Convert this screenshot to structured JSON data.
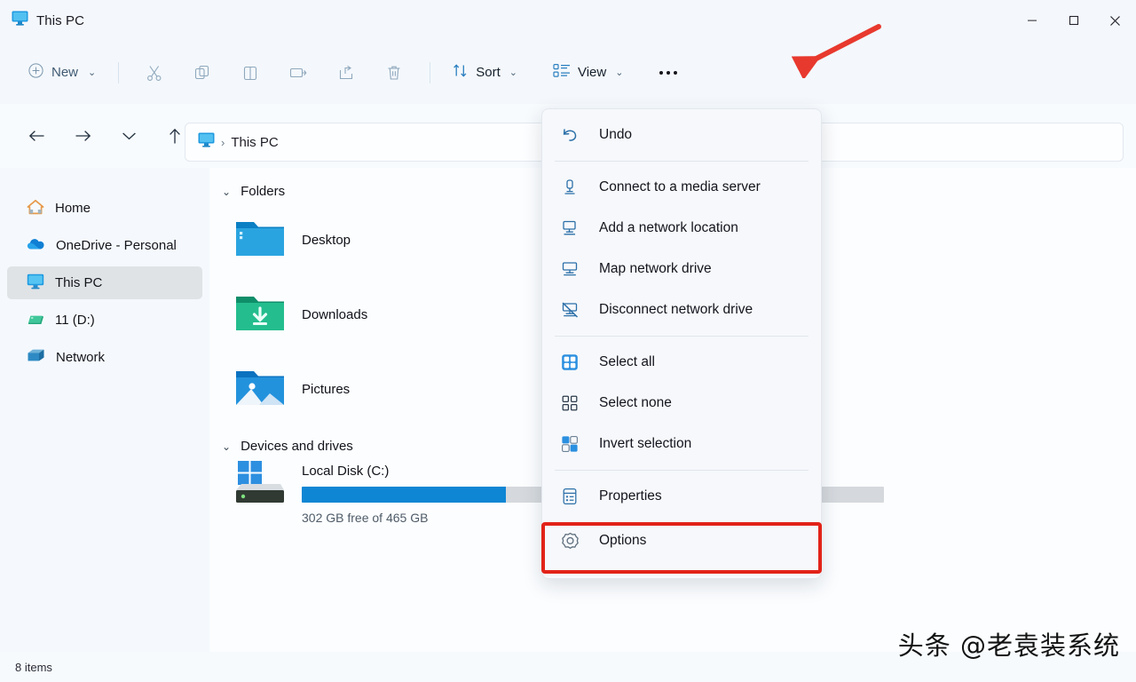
{
  "window": {
    "title": "This PC",
    "title_icon": "this-pc-monitor-icon",
    "controls": {
      "minimize": "─",
      "maximize": "□",
      "close": "✕"
    }
  },
  "toolbar": {
    "new_label": "New",
    "new_chevron": "⌄",
    "icons": [
      "cut-icon",
      "copy-icon",
      "paste-icon",
      "rename-icon",
      "share-icon",
      "delete-icon"
    ],
    "sort_label": "Sort",
    "sort_chevron": "⌄",
    "view_label": "View",
    "view_chevron": "⌄",
    "more_label": "•••"
  },
  "navigation": {
    "back": "←",
    "forward": "→",
    "recent": "⌄",
    "up": "↑"
  },
  "address": {
    "icon": "this-pc-monitor-icon",
    "separator": "›",
    "crumb": "This PC"
  },
  "sidebar": {
    "items": [
      {
        "label": "Home",
        "icon": "home-icon",
        "selected": false
      },
      {
        "label": "OneDrive - Personal",
        "icon": "onedrive-cloud-icon",
        "selected": false
      },
      {
        "label": "This PC",
        "icon": "this-pc-monitor-icon",
        "selected": true
      },
      {
        "label": "11 (D:)",
        "icon": "drive-green-icon",
        "selected": false
      },
      {
        "label": "Network",
        "icon": "network-icon",
        "selected": false
      }
    ]
  },
  "content": {
    "folders_group": {
      "chevron": "⌄",
      "label": "Folders",
      "items": [
        {
          "label": "Desktop",
          "icon": "desktop-folder-icon"
        },
        {
          "label": "Downloads",
          "icon": "downloads-folder-icon"
        },
        {
          "label": "Pictures",
          "icon": "pictures-folder-icon"
        }
      ]
    },
    "devices_group": {
      "chevron": "⌄",
      "label": "Devices and drives",
      "drive": {
        "name": "Local Disk (C:)",
        "icon": "local-disk-windows-icon",
        "free_text": "302 GB free of 465 GB",
        "used_percent": 35,
        "bar_color": "#0e86d4"
      }
    }
  },
  "status": {
    "items_count": "8 items"
  },
  "context_menu": {
    "sections": [
      {
        "items": [
          {
            "label": "Undo",
            "icon": "undo-arrow-icon"
          }
        ]
      },
      {
        "items": [
          {
            "label": "Connect to a media server",
            "icon": "media-server-icon"
          },
          {
            "label": "Add a network location",
            "icon": "add-network-location-icon"
          },
          {
            "label": "Map network drive",
            "icon": "map-network-drive-icon"
          },
          {
            "label": "Disconnect network drive",
            "icon": "disconnect-network-drive-icon"
          }
        ]
      },
      {
        "items": [
          {
            "label": "Select all",
            "icon": "select-all-icon"
          },
          {
            "label": "Select none",
            "icon": "select-none-icon"
          },
          {
            "label": "Invert selection",
            "icon": "invert-selection-icon"
          }
        ]
      },
      {
        "items": [
          {
            "label": "Properties",
            "icon": "properties-icon"
          },
          {
            "label": "Options",
            "icon": "options-gear-icon",
            "highlighted": true
          }
        ]
      }
    ]
  },
  "annotations": {
    "highlight_color": "#e22319",
    "arrow_color": "#e8392e",
    "arrow_target": "more-options-button"
  },
  "watermark": {
    "text": "头条 @老袁装系统"
  }
}
